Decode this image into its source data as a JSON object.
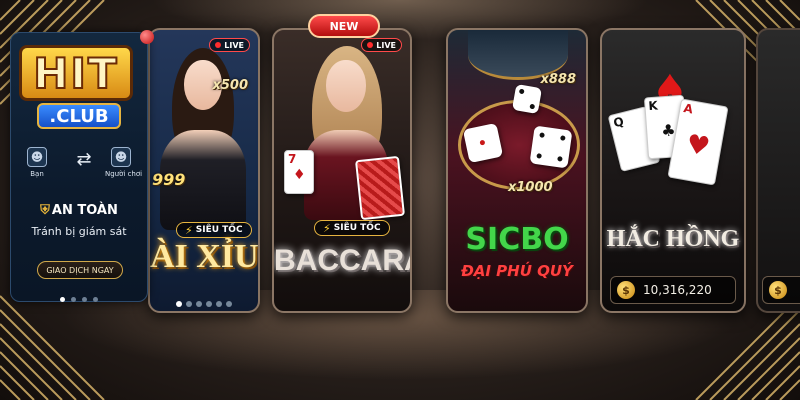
{
  "logo": {
    "main": "HIT",
    "sub": ".CLUB"
  },
  "side_panel": {
    "friend_left": "Bạn",
    "friend_right": "Người chơi",
    "safe_title": "AN TOÀN",
    "safe_subtitle": "Tránh bị giám sát",
    "trade_button": "GIAO DỊCH NGAY",
    "active_dot": 1,
    "dot_count": 4
  },
  "badges": {
    "live": "LIVE",
    "new": "NEW",
    "speed": "SIÊU TỐC"
  },
  "games": {
    "taixiu": {
      "title": "ÀI XỈU",
      "multiplier_top": "x500",
      "multiplier_side": "999"
    },
    "baccarat": {
      "title": "BACCARAT"
    },
    "sicbo": {
      "title": "SICBO",
      "subtitle": "ĐẠI PHÚ QUÝ",
      "multiplier_top": "x888",
      "multiplier_bottom": "x1000"
    },
    "hachong": {
      "title": "HẮC HỒNG",
      "jackpot": "10,316,220",
      "currency_symbol": "$"
    }
  },
  "playing_cards": {
    "baccarat_front": "7",
    "hachong_q": "Q",
    "hachong_k": "K",
    "hachong_a": "A"
  },
  "colors": {
    "gold": "#e6b440",
    "live_red": "#ff2d2d",
    "sicbo_green": "#43d64a",
    "sicbo_red": "#ff4040"
  }
}
